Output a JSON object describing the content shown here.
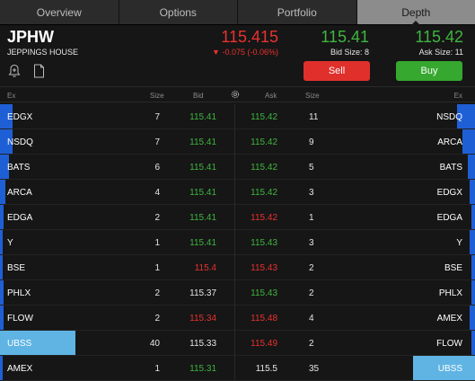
{
  "tabs": [
    "Overview",
    "Options",
    "Portfolio",
    "Depth"
  ],
  "active_tab": "Depth",
  "quote": {
    "symbol": "JPHW",
    "company": "JEPPINGS HOUSE",
    "last": "115.415",
    "change": "▼ -0.075 (-0.06%)",
    "bid": "115.41",
    "bid_size": "Bid Size: 8",
    "ask": "115.42",
    "ask_size": "Ask Size: 11"
  },
  "actions": {
    "sell": "Sell",
    "buy": "Buy"
  },
  "columns": {
    "ex": "Ex",
    "size": "Size",
    "bid": "Bid",
    "ask": "Ask",
    "size2": "Size",
    "ex2": "Ex"
  },
  "icons": [
    "bell-plus-icon",
    "document-icon",
    "gear-icon"
  ],
  "colors": {
    "up": "#3fb53f",
    "down": "#e8322f",
    "bar": "#1f5fd6",
    "bar_highlight": "#5fb4e3",
    "tab_active": "#8c8c8c"
  },
  "rows": [
    {
      "ex_l": "EDGX",
      "size_l": "7",
      "bid": "115.41",
      "bid_c": "green",
      "ask": "115.42",
      "ask_c": "green",
      "size_r": "11",
      "ex_r": "NSDQ",
      "lbar": 0.026,
      "rbar": 0.038
    },
    {
      "ex_l": "NSDQ",
      "size_l": "7",
      "bid": "115.41",
      "bid_c": "green",
      "ask": "115.42",
      "ask_c": "green",
      "size_r": "9",
      "ex_r": "ARCA",
      "lbar": 0.026,
      "rbar": 0.026
    },
    {
      "ex_l": "BATS",
      "size_l": "6",
      "bid": "115.41",
      "bid_c": "green",
      "ask": "115.42",
      "ask_c": "green",
      "size_r": "5",
      "ex_r": "BATS",
      "lbar": 0.019,
      "rbar": 0.015
    },
    {
      "ex_l": "ARCA",
      "size_l": "4",
      "bid": "115.41",
      "bid_c": "green",
      "ask": "115.42",
      "ask_c": "green",
      "size_r": "3",
      "ex_r": "EDGX",
      "lbar": 0.011,
      "rbar": 0.011
    },
    {
      "ex_l": "EDGA",
      "size_l": "2",
      "bid": "115.41",
      "bid_c": "green",
      "ask": "115.42",
      "ask_c": "red",
      "size_r": "1",
      "ex_r": "EDGA",
      "lbar": 0.008,
      "rbar": 0.008
    },
    {
      "ex_l": "Y",
      "size_l": "1",
      "bid": "115.41",
      "bid_c": "green",
      "ask": "115.43",
      "ask_c": "green",
      "size_r": "3",
      "ex_r": "Y",
      "lbar": 0.006,
      "rbar": 0.011
    },
    {
      "ex_l": "BSE",
      "size_l": "1",
      "bid": "115.4",
      "bid_c": "red",
      "ask": "115.43",
      "ask_c": "red",
      "size_r": "2",
      "ex_r": "BSE",
      "lbar": 0.006,
      "rbar": 0.008
    },
    {
      "ex_l": "PHLX",
      "size_l": "2",
      "bid": "115.37",
      "bid_c": "white",
      "ask": "115.43",
      "ask_c": "green",
      "size_r": "2",
      "ex_r": "PHLX",
      "lbar": 0.008,
      "rbar": 0.008
    },
    {
      "ex_l": "FLOW",
      "size_l": "2",
      "bid": "115.34",
      "bid_c": "red",
      "ask": "115.48",
      "ask_c": "red",
      "size_r": "4",
      "ex_r": "AMEX",
      "lbar": 0.008,
      "rbar": 0.011
    },
    {
      "ex_l": "UBSS",
      "size_l": "40",
      "bid": "115.33",
      "bid_c": "white",
      "ask": "115.49",
      "ask_c": "red",
      "size_r": "2",
      "ex_r": "FLOW",
      "lbar": 0.159,
      "rbar": 0.008,
      "lhl": true
    },
    {
      "ex_l": "AMEX",
      "size_l": "1",
      "bid": "115.31",
      "bid_c": "green",
      "ask": "115.5",
      "ask_c": "white",
      "size_r": "35",
      "ex_r": "UBSS",
      "lbar": 0.006,
      "rbar": 0.13,
      "rhl": true
    }
  ]
}
